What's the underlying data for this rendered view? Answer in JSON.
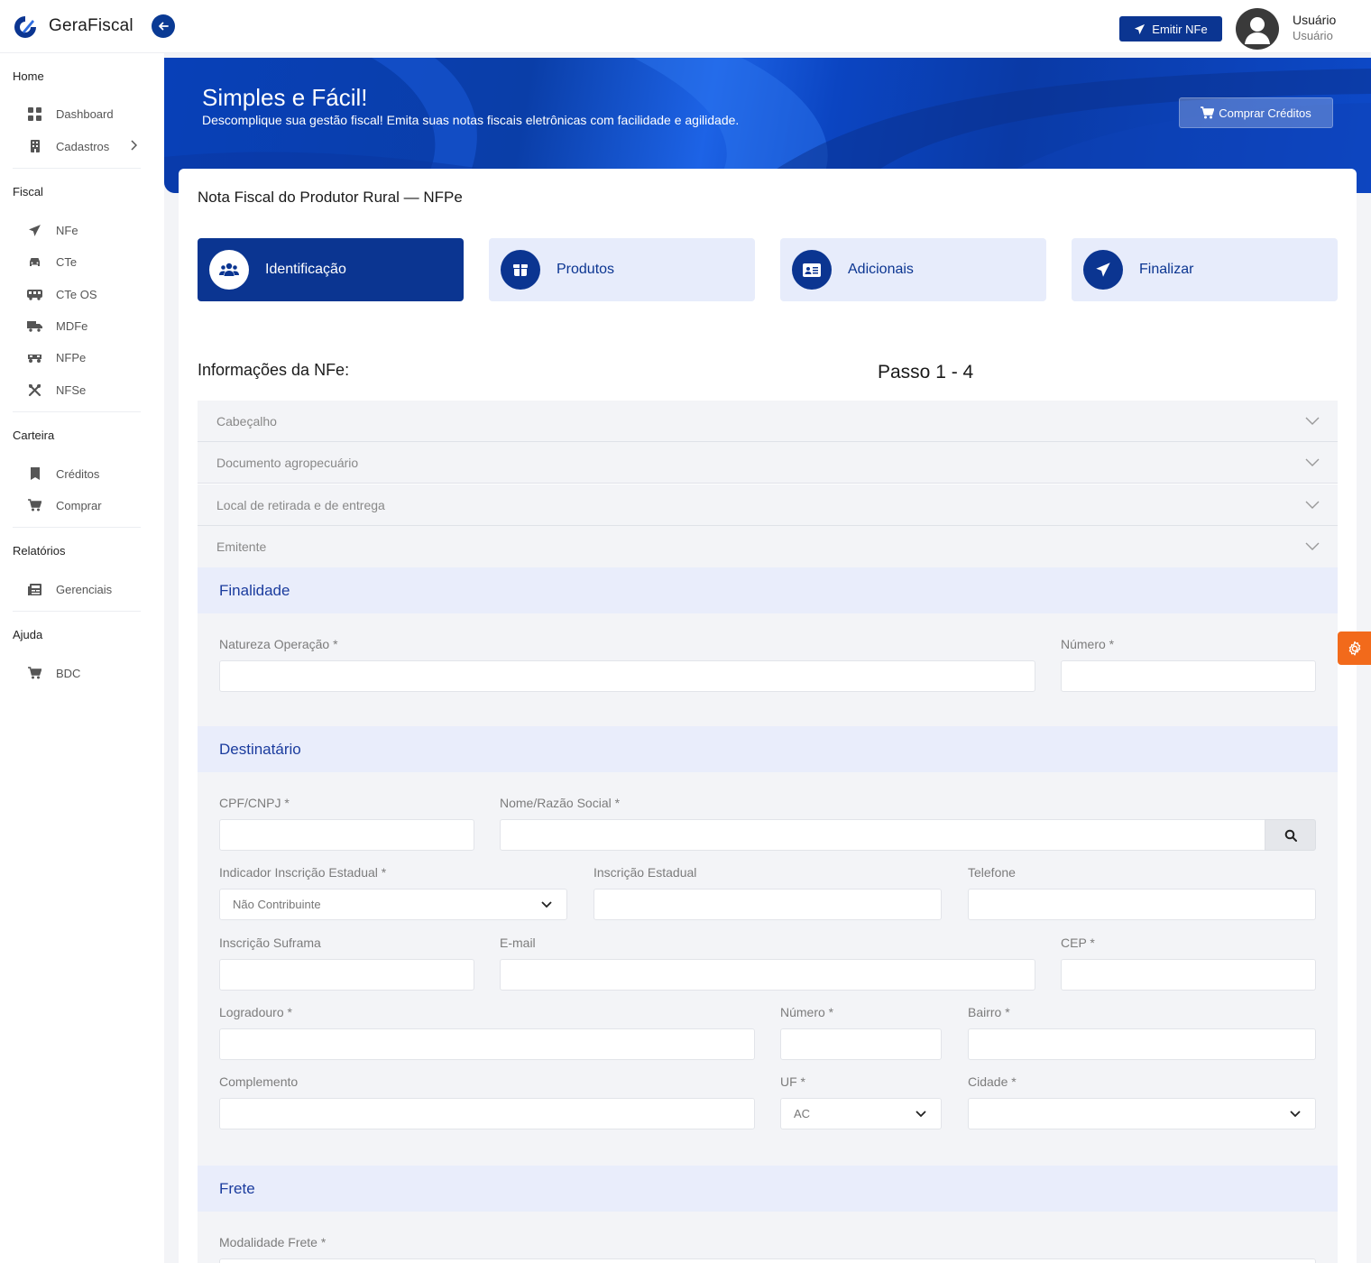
{
  "app": {
    "name": "GeraFiscal"
  },
  "header": {
    "emit_label": "Emitir NFe",
    "user_name": "Usuário",
    "user_role": "Usuário"
  },
  "sidebar": {
    "sections": [
      {
        "title": "Home",
        "items": [
          {
            "label": "Dashboard",
            "icon": "grid-icon"
          },
          {
            "label": "Cadastros",
            "icon": "building-icon"
          }
        ]
      },
      {
        "title": "Fiscal",
        "items": [
          {
            "label": "NFe",
            "icon": "send-icon"
          },
          {
            "label": "CTe",
            "icon": "car-icon"
          },
          {
            "label": "CTe OS",
            "icon": "bus-icon"
          },
          {
            "label": "MDFe",
            "icon": "truck-icon"
          },
          {
            "label": "NFPe",
            "icon": "tractor-icon"
          },
          {
            "label": "NFSe",
            "icon": "tools-icon"
          }
        ]
      },
      {
        "title": "Carteira",
        "items": [
          {
            "label": "Créditos",
            "icon": "bookmark-icon"
          },
          {
            "label": "Comprar",
            "icon": "cart-icon"
          }
        ]
      },
      {
        "title": "Relatórios",
        "items": [
          {
            "label": "Gerenciais",
            "icon": "newspaper-icon"
          }
        ]
      },
      {
        "title": "Ajuda",
        "items": [
          {
            "label": "BDC",
            "icon": "cart-icon"
          }
        ]
      }
    ]
  },
  "banner": {
    "title": "Simples e Fácil!",
    "subtitle": "Descomplique sua gestão fiscal! Emita suas notas fiscais eletrônicas com facilidade e agilidade.",
    "buy_label": "Comprar Créditos"
  },
  "page": {
    "title": "Nota Fiscal do Produtor Rural — NFPe",
    "steps": [
      {
        "label": "Identificação",
        "icon": "users-icon",
        "active": true
      },
      {
        "label": "Produtos",
        "icon": "box-icon",
        "active": false
      },
      {
        "label": "Adicionais",
        "icon": "id-card-icon",
        "active": false
      },
      {
        "label": "Finalizar",
        "icon": "send-icon",
        "active": false
      }
    ],
    "info_title": "Informações da NFe:",
    "step_indicator": "Passo 1 - 4",
    "accordions": [
      "Cabeçalho",
      "Documento agropecuário",
      "Local de retirada e de entrega",
      "Emitente"
    ]
  },
  "finalidade": {
    "title": "Finalidade",
    "natureza_label": "Natureza Operação *",
    "numero_label": "Número *"
  },
  "destinatario": {
    "title": "Destinatário",
    "cpf_label": "CPF/CNPJ *",
    "nome_label": "Nome/Razão Social *",
    "indicador_label": "Indicador Inscrição Estadual *",
    "indicador_value": "Não Contribuinte",
    "ie_label": "Inscrição Estadual",
    "telefone_label": "Telefone",
    "suframa_label": "Inscrição Suframa",
    "email_label": "E-mail",
    "cep_label": "CEP *",
    "logradouro_label": "Logradouro *",
    "numero_label": "Número *",
    "bairro_label": "Bairro *",
    "complemento_label": "Complemento",
    "uf_label": "UF *",
    "uf_value": "AC",
    "cidade_label": "Cidade *",
    "cidade_value": ""
  },
  "frete": {
    "title": "Frete",
    "modalidade_label": "Modalidade Frete *"
  },
  "colors": {
    "primary": "#0b3591",
    "accent_orange": "#f26a1b",
    "section_head": "#e9edfb"
  }
}
